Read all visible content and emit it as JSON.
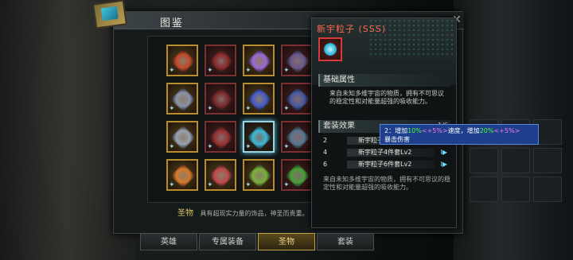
{
  "window": {
    "title": "图鉴"
  },
  "grid": {
    "items": [
      {
        "name": "item-1",
        "style": "gold"
      },
      {
        "name": "item-2",
        "style": "red"
      },
      {
        "name": "item-3",
        "style": "gold"
      },
      {
        "name": "item-4",
        "style": "red"
      },
      {
        "name": "item-5",
        "style": "gold"
      },
      {
        "name": "item-6",
        "style": "red"
      },
      {
        "name": "item-7",
        "style": "gold"
      },
      {
        "name": "item-8",
        "style": "red"
      },
      {
        "name": "item-9",
        "style": "gold"
      },
      {
        "name": "item-10",
        "style": "red"
      },
      {
        "name": "item-11",
        "style": "sel"
      },
      {
        "name": "item-12",
        "style": "red"
      },
      {
        "name": "item-13",
        "style": "gold"
      },
      {
        "name": "item-14",
        "style": "gold"
      },
      {
        "name": "item-15",
        "style": "gold"
      },
      {
        "name": "item-16",
        "style": "red"
      }
    ]
  },
  "category": {
    "key": "圣物",
    "text": "具有超现实力量的饰品，神圣而贵重。"
  },
  "tabs": [
    {
      "label": "英雄",
      "active": false
    },
    {
      "label": "专属装备",
      "active": false
    },
    {
      "label": "圣物",
      "active": true
    },
    {
      "label": "套装",
      "active": false
    }
  ],
  "detail": {
    "name": "新宇粒子 (SSS)",
    "section_basic": "基础属性",
    "basic_desc": "来自未知多维宇宙的物质，拥有不可思议的稳定性和对能量超强的吸收能力。",
    "section_set": "套装效果",
    "set_count": "1/6",
    "set_rows": [
      {
        "num": "2",
        "text": "新宇粒子2件套Lv2"
      },
      {
        "num": "4",
        "text": "新宇粒子4件套Lv2"
      },
      {
        "num": "6",
        "text": "新宇粒子6件套Lv2"
      }
    ],
    "flavor": "来自未知多维宇宙的物质，拥有不可思议的稳定性和对能量超强的吸收能力。"
  },
  "tooltip": {
    "prefix": "2：增加",
    "v1": "10%",
    "v1b": "<+5%>",
    "mid": "速度，增加",
    "v2": "20%",
    "v2b": "<+5%>",
    "line2": "暴击伤害"
  },
  "colors": {
    "gem_colors": [
      "#c24a2c",
      "#8a2a2a",
      "#9c6ad0",
      "#6a5a8a",
      "#8a93a8",
      "#7a2a2a",
      "#4a5cc8",
      "#4a5aa0",
      "#9aa2b0",
      "#9a3232",
      "#3fb8d6",
      "#5a7890",
      "#d87a2a",
      "#c24a4a",
      "#7ab03a",
      "#4aa03a"
    ]
  }
}
